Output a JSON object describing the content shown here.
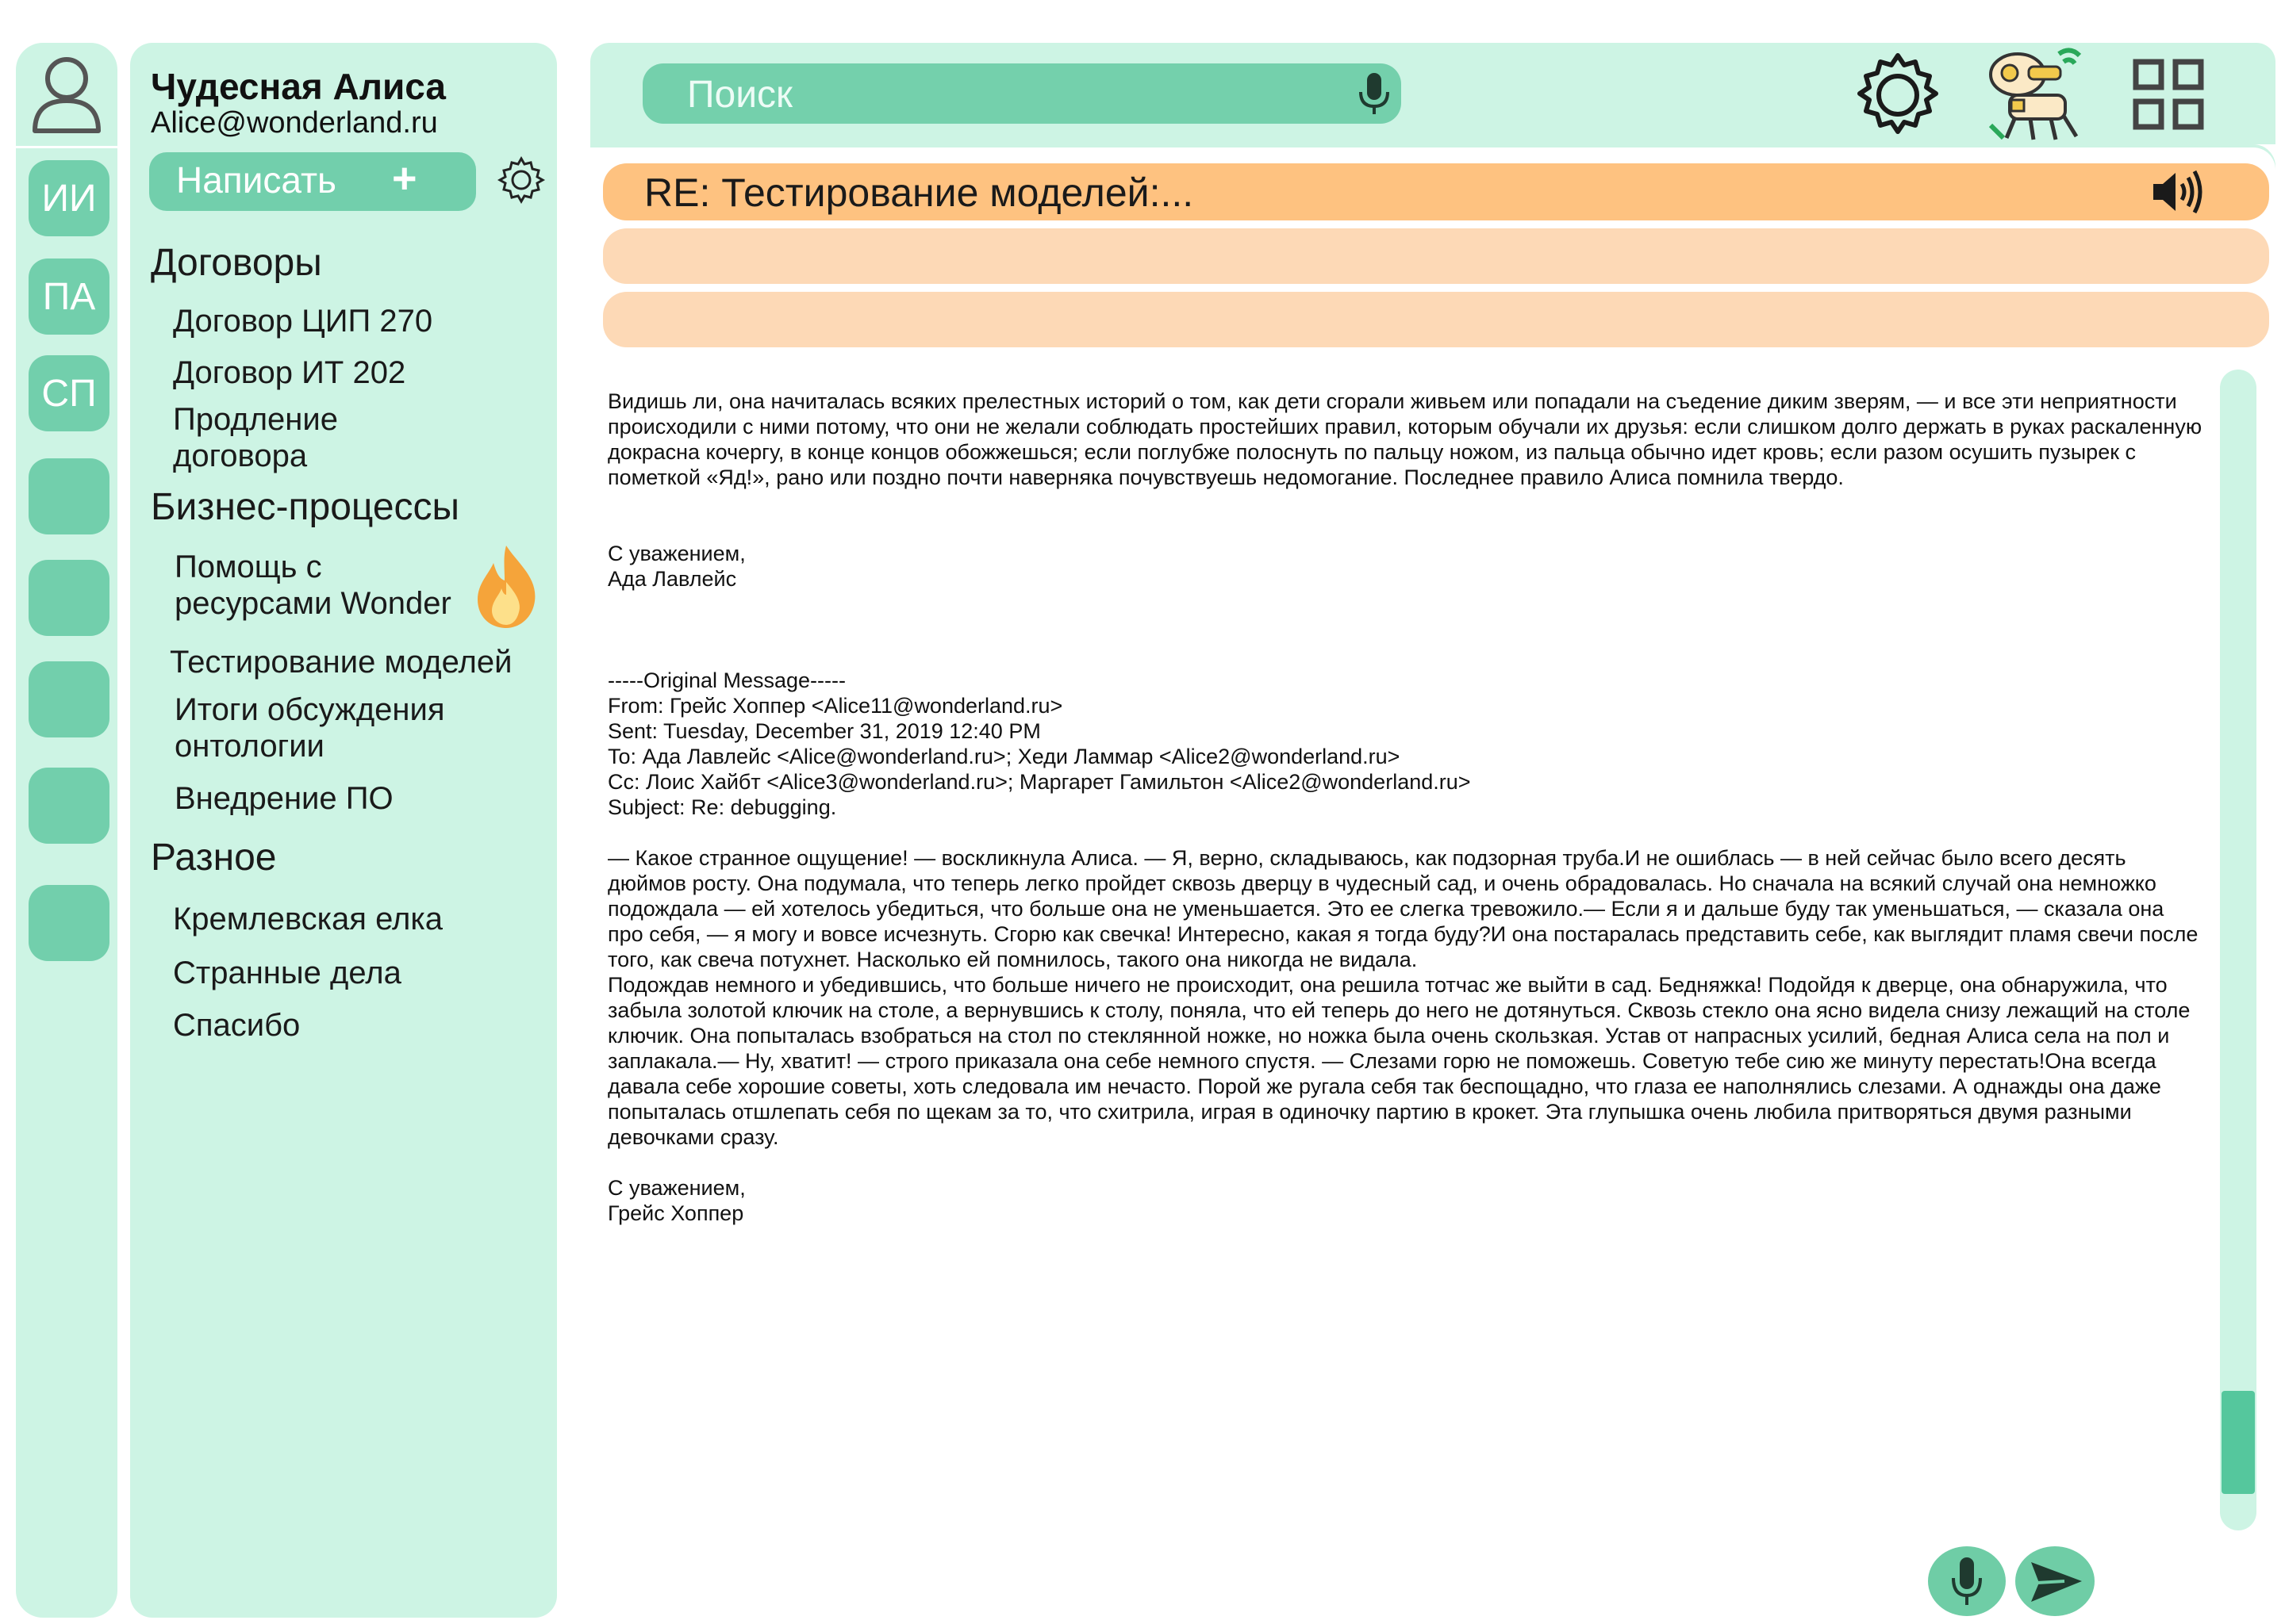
{
  "rail": {
    "avatar_icon": "user-icon",
    "items": [
      {
        "label": "ИИ"
      },
      {
        "label": "ПА"
      },
      {
        "label": "СП"
      },
      {
        "label": ""
      },
      {
        "label": ""
      },
      {
        "label": ""
      },
      {
        "label": ""
      },
      {
        "label": ""
      }
    ]
  },
  "user": {
    "name": "Чудесная Алиса",
    "email": "Alice@wonderland.ru"
  },
  "compose": {
    "label": "Написать",
    "plus": "+"
  },
  "sections": {
    "contracts": {
      "title": "Договоры",
      "items": [
        "Договор ЦИП 270",
        "Договор ИТ 202",
        "Продление\nдоговора"
      ]
    },
    "business": {
      "title": "Бизнес-процессы",
      "items": [
        "Помощь с\nресурсами Wonder",
        "Тестирование моделей",
        "Итоги обсуждения\nонтологии",
        "Внедрение ПО"
      ]
    },
    "misc": {
      "title": "Разное",
      "items": [
        "Кремлевская елка",
        "Странные дела",
        "Спасибо"
      ]
    }
  },
  "search": {
    "placeholder": "Поиск"
  },
  "message": {
    "subject": "RE: Тестирование моделей:...",
    "paragraph1": "Видишь ли, она начиталась всяких прелестных историй о том, как дети сгорали живьем или попадали на съедение диким зверям, — и все эти неприятности происходили с ними потому, что они не желали соблюдать простейших правил, которым обучали их друзья: если слишком долго держать в руках раскаленную докрасна кочергу, в конце концов обожжешься; если поглубже полоснуть по пальцу ножом, из пальца обычно идет кровь; если разом осушить пузырек с пометкой «Яд!», рано или поздно почти наверняка почувствуешь недомогание. Последнее правило Алиса помнила твердо.",
    "regards1": "С уважением,",
    "sign1": "Ада Лавлейс",
    "original_header": "-----Original Message-----",
    "from": "From: Грейс Хоппер <Alice11@wonderland.ru>",
    "sent": "Sent: Tuesday, December 31, 2019 12:40 PM",
    "to": "To: Ада Лавлейс  <Alice@wonderland.ru>; Хеди Ламмар <Alice2@wonderland.ru>",
    "cc": "Cc: Лоис Хайбт <Alice3@wonderland.ru>; Маргарет Гамильтон <Alice2@wonderland.ru>",
    "subject_line": "Subject: Re: debugging.",
    "paragraph2": "— Какое странное ощущение! — воскликнула Алиса. — Я, верно, складываюсь, как подзорная труба.И не ошиблась — в ней сейчас было всего десять дюймов росту. Она подумала, что теперь легко пройдет сквозь дверцу в чудесный сад, и очень обрадовалась. Но сначала на всякий случай она немножко подождала — ей хотелось убедиться, что больше она не уменьшается. Это ее слегка тревожило.— Если я и дальше буду так уменьшаться, — сказала она про себя, — я могу и вовсе исчезнуть. Сгорю как свечка! Интересно, какая я тогда буду?И она постаралась представить себе, как выглядит пламя свечи после того, как свеча потухнет. Насколько ей помнилось, такого она никогда не видала.",
    "paragraph3": "Подождав немного и убедившись, что больше ничего не происходит, она решила тотчас же выйти в сад. Бедняжка! Подойдя к дверце, она обнаружила, что забыла золотой ключик на столе, а вернувшись к столу, поняла, что ей теперь до него не дотянуться. Сквозь стекло она ясно видела снизу лежащий на столе ключик. Она попыталась взобраться на стол по стеклянной ножке, но ножка была очень скользкая. Устав от напрасных усилий, бедная Алиса села на пол и заплакала.— Ну, хватит! — строго приказала она себе немного спустя. — Слезами горю не поможешь. Советую тебе сию же минуту перестать!Она всегда давала себе хорошие советы, хоть следовала им нечасто. Порой же ругала себя так беспощадно, что глаза ее наполнялись слезами. А однажды она даже попыталась отшлепать себя по щекам за то, что схитрила, играя в одиночку партию в крокет. Эта глупышка очень любила притворяться двумя разными девочками сразу.",
    "regards2": "С уважением,",
    "sign2": "Грейс Хоппер"
  },
  "colors": {
    "panel_bg": "#cdf4e4",
    "accent_green": "#72cfac",
    "active_message": "#fec280",
    "message_bar": "#fdd9b6"
  },
  "icons": [
    "user-icon",
    "gear-icon",
    "microphone-icon",
    "robot-icon",
    "grid-icon",
    "speaker-icon",
    "fire-icon",
    "send-icon"
  ]
}
